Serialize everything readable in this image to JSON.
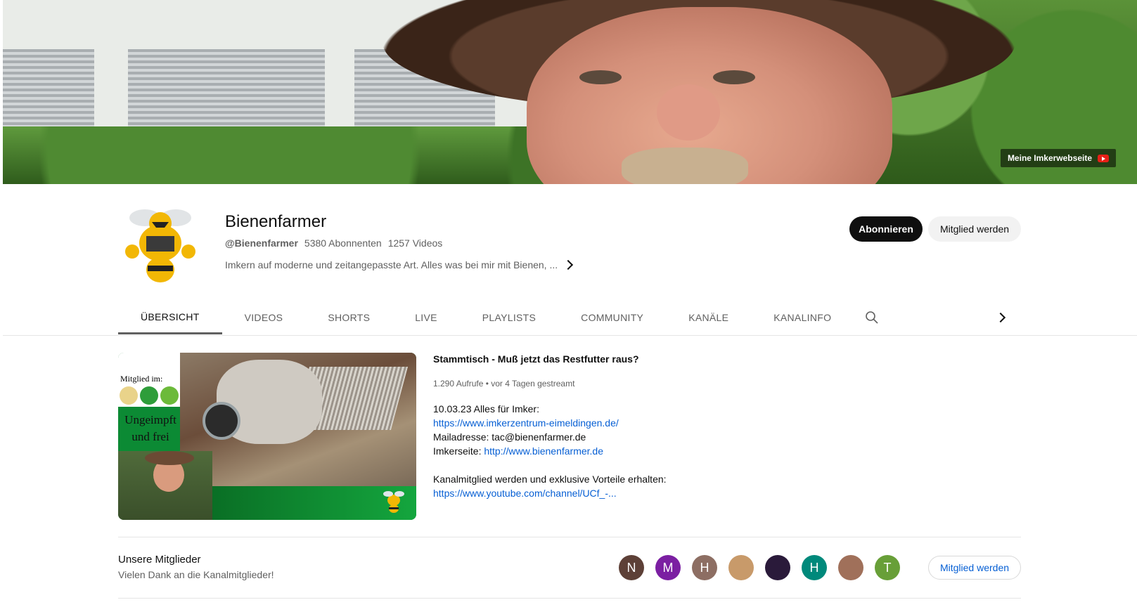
{
  "banner": {
    "link_label": "Meine Imkerwebseite"
  },
  "channel": {
    "name": "Bienenfarmer",
    "handle": "@Bienenfarmer",
    "subscribers": "5380 Abonnenten",
    "videos": "1257 Videos",
    "description": "Imkern auf moderne und zeitangepasste Art. Alles was bei mir mit Bienen, ...",
    "subscribe_label": "Abonnieren",
    "member_label": "Mitglied werden"
  },
  "tabs": [
    {
      "label": "ÜBERSICHT",
      "active": true
    },
    {
      "label": "VIDEOS"
    },
    {
      "label": "SHORTS"
    },
    {
      "label": "LIVE"
    },
    {
      "label": "PLAYLISTS"
    },
    {
      "label": "COMMUNITY"
    },
    {
      "label": "KANÄLE"
    },
    {
      "label": "KANALINFO"
    }
  ],
  "featured": {
    "thumb_text_member": "Mitglied im:",
    "thumb_text_1": "Ungeimpft",
    "thumb_text_2": "und frei",
    "title": "Stammtisch - Muß jetzt das Restfutter raus?",
    "meta": "1.290 Aufrufe • vor 4 Tagen gestreamt",
    "desc": {
      "line1": "10.03.23 Alles für Imker:",
      "link1": "https://www.imkerzentrum-eimeldingen.de/",
      "line3": "Mailadresse: tac@bienenfarmer.de",
      "line4_prefix": "Imkerseite: ",
      "link2": "http://www.bienenfarmer.de",
      "line6": "Kanalmitglied werden und exklusive Vorteile erhalten:",
      "link3": "https://www.youtube.com/channel/UCf_-..."
    }
  },
  "members": {
    "title": "Unsere Mitglieder",
    "subtitle": "Vielen Dank an die Kanalmitglieder!",
    "button_label": "Mitglied werden",
    "avatars": [
      {
        "letter": "N",
        "color": "#5d4037"
      },
      {
        "letter": "M",
        "color": "#7b1fa2"
      },
      {
        "letter": "H",
        "color": "#8d6e63"
      },
      {
        "letter": "",
        "color": "#c89a6a"
      },
      {
        "letter": "",
        "color": "#2a1a3a"
      },
      {
        "letter": "H",
        "color": "#00897b"
      },
      {
        "letter": "",
        "color": "#a0705a"
      },
      {
        "letter": "T",
        "color": "#689f38"
      }
    ]
  },
  "colors": {
    "link": "#065fd4",
    "subscribe_bg": "#0f0f0f",
    "secondary_btn_bg": "#f2f2f2"
  }
}
